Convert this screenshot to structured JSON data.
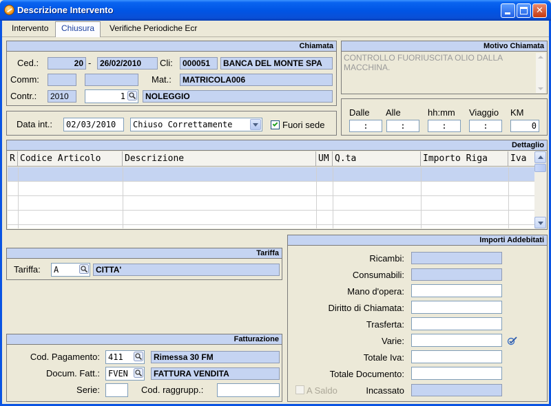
{
  "window": {
    "title": "Descrizione Intervento"
  },
  "tabs": [
    {
      "label": "Intervento"
    },
    {
      "label": "Chiusura"
    },
    {
      "label": "Verifiche Periodiche Ecr"
    }
  ],
  "chiamata": {
    "header": "Chiamata",
    "ced_label": "Ced.:",
    "ced_number": "20",
    "ced_sep": "-",
    "ced_date": "26/02/2010",
    "cli_label": "Cli:",
    "cli_code": "000051",
    "cli_name": "BANCA DEL MONTE SPA",
    "comm_label": "Comm:",
    "comm_value1": "",
    "comm_value2": "",
    "mat_label": "Mat.:",
    "mat_value": "MATRICOLA006",
    "contr_label": "Contr.:",
    "contr_year": "2010",
    "contr_number": "1",
    "contr_desc": "NOLEGGIO"
  },
  "motivo": {
    "header": "Motivo Chiamata",
    "text": "CONTROLLO FUORIUSCITA OLIO DALLA MACCHINA."
  },
  "data_int": {
    "label": "Data int.:",
    "value": "02/03/2010",
    "status": "Chiuso Correttamente",
    "fuori_sede_label": "Fuori sede",
    "fuori_sede_checked": true
  },
  "orari": {
    "dalle_label": "Dalle",
    "dalle_value": " :",
    "alle_label": "Alle",
    "alle_value": " :",
    "hhmm_label": "hh:mm",
    "hhmm_value": " :",
    "viaggio_label": "Viaggio",
    "viaggio_value": " :",
    "km_label": "KM",
    "km_value": "0"
  },
  "dettaglio": {
    "header": "Dettaglio",
    "columns": [
      "R",
      "Codice Articolo",
      "Descrizione",
      "UM",
      "Q.ta",
      "Importo Riga",
      "Iva"
    ],
    "rows": []
  },
  "tariffa": {
    "header": "Tariffa",
    "label": "Tariffa:",
    "code": "A",
    "desc": "CITTA'"
  },
  "fatturazione": {
    "header": "Fatturazione",
    "cod_pag_label": "Cod. Pagamento:",
    "cod_pag_code": "411",
    "cod_pag_desc": "Rimessa 30 FM",
    "docum_label": "Docum. Fatt.:",
    "docum_code": "FVEN",
    "docum_desc": "FATTURA VENDITA",
    "serie_label": "Serie:",
    "serie_value": "",
    "raggr_label": "Cod. raggrupp.:",
    "raggr_value": ""
  },
  "importi": {
    "header": "Importi Addebitati",
    "ricambi_label": "Ricambi:",
    "ricambi_value": "",
    "consumabili_label": "Consumabili:",
    "consumabili_value": "",
    "manodopera_label": "Mano d'opera:",
    "manodopera_value": "",
    "diritto_label": "Diritto di Chiamata:",
    "diritto_value": "",
    "trasferta_label": "Trasferta:",
    "trasferta_value": "",
    "varie_label": "Varie:",
    "varie_value": "",
    "totale_iva_label": "Totale Iva:",
    "totale_iva_value": "",
    "totale_doc_label": "Totale Documento:",
    "totale_doc_value": "",
    "a_saldo_label": "A Saldo",
    "incassato_label": "Incassato",
    "incassato_value": ""
  },
  "colors": {
    "titlebar": "#0055e5",
    "header_band": "#c5d4f2",
    "window_bg": "#ece9d8"
  }
}
